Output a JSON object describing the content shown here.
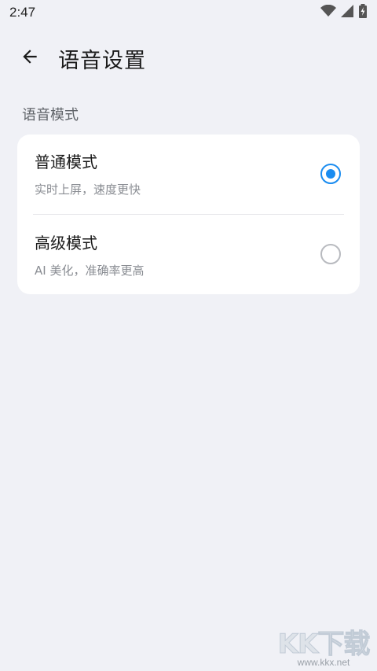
{
  "status_bar": {
    "time": "2:47",
    "icons": [
      "wifi-icon",
      "cellular-signal-icon",
      "battery-charging-icon"
    ]
  },
  "app_bar": {
    "back_icon": "arrow-left-icon",
    "title": "语音设置"
  },
  "section": {
    "header": "语音模式"
  },
  "options": [
    {
      "title": "普通模式",
      "subtitle": "实时上屏，速度更快",
      "selected": true
    },
    {
      "title": "高级模式",
      "subtitle": "AI 美化，准确率更高",
      "selected": false
    }
  ],
  "colors": {
    "background": "#f0f1f6",
    "card": "#ffffff",
    "accent": "#1a8cf0",
    "radio_unchecked": "#b8babf"
  },
  "watermark": {
    "logo": "KK下载",
    "url": "www.kkx.net"
  }
}
